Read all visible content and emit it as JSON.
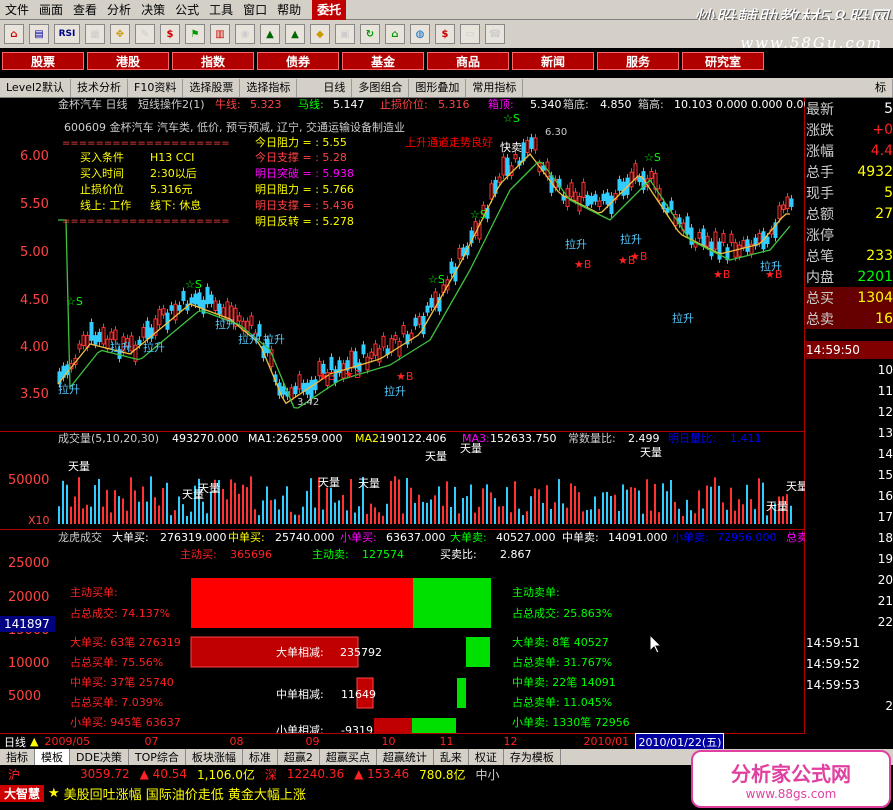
{
  "menu": [
    "文件",
    "画面",
    "查看",
    "分析",
    "决策",
    "公式",
    "工具",
    "窗口",
    "帮助",
    "委托"
  ],
  "brand": "炒股輔助教材58股网",
  "watermark": "www.58Gu.com",
  "toolbar": {
    "icons": [
      "home-icon",
      "chart-icon",
      "rsi-icon",
      "grid-icon",
      "cursor-icon",
      "pencil-icon",
      "dollar-icon",
      "flag-icon",
      "bars-icon",
      "binoculars-icon",
      "stack-icon",
      "stack2-icon",
      "diamond-icon",
      "note-icon",
      "rotate-icon",
      "home2-icon",
      "globe-icon",
      "dollar2-icon",
      "monitor-icon",
      "phone-icon"
    ],
    "rsi_label": "RSI",
    "dollar_label": "$"
  },
  "nav": [
    "股票",
    "港股",
    "指数",
    "债券",
    "基金",
    "商品",
    "新闻",
    "服务",
    "研究室"
  ],
  "subbar": [
    "Level2默认",
    "技术分析",
    "F10资料",
    "选择股票",
    "选择指标",
    "日线",
    "多图组合",
    "图形叠加",
    "常用指标",
    "标"
  ],
  "header": {
    "stock": "金杯汽车 日线",
    "indicator": "短线操作2(1)",
    "niuxian_label": "牛线:",
    "niuxian": "5.323",
    "maxian_label": "马线:",
    "maxian": "5.147",
    "stoploss_label": "止损价位:",
    "stoploss": "5.316",
    "box_top_label": "箱顶:",
    "box_top": "5.340",
    "box_bottom_label": "箱底:",
    "box_bottom": "4.850",
    "box_high_label": "箱高:",
    "box_high": "10.103",
    "v1": "0.000",
    "v2": "0.000",
    "v3": "0.000"
  },
  "info": {
    "code_line": "600609  金杯汽车  汽车类, 低价, 预亏预减, 辽宁, 交通运输设备制造业",
    "buy_cond_l": "买入条件",
    "buy_cond_v": "H13 CCI",
    "buy_time_l": "买入时间",
    "buy_time_v": "2:30以后",
    "stop_l": "止损价位",
    "stop_v": "5.316元",
    "online_l": "线上: 工作",
    "offline_l": "线下: 休息",
    "dashes": "====================",
    "today_res": "今日阻力 = : 5.55",
    "today_sup": "今日支撑 = : 5.28",
    "tomorrow_break": "明日突破 = : 5.938",
    "tomorrow_res": "明日阻力 = : 5.766",
    "tomorrow_sup": "明日支撑 = : 5.436",
    "tomorrow_rev": "明日反转 = : 5.278",
    "up_note": "上升通道走势良好"
  },
  "price_axis": [
    "6.00",
    "5.50",
    "5.00",
    "4.50",
    "4.00",
    "3.50"
  ],
  "markers": {
    "lasheng": "拉升",
    "kuaimai": "快卖",
    "star_s": "☆S",
    "star_b": "★B",
    "high": "6.30",
    "low": "3.42"
  },
  "volume": {
    "label": "成交量(5,10,20,30)",
    "value": "493270.000",
    "ma1_label": "MA1:",
    "ma1": "262559.000",
    "ma2_label": "MA2:",
    "ma2": "190122.406",
    "ma3_label": "MA3:",
    "ma3": "152633.750",
    "ratio_label": "常数量比:",
    "ratio": "2.499",
    "tianliang": "天量",
    "axis": [
      "50000",
      "X10"
    ],
    "extra_label": "明日量比:",
    "extra": "1.411"
  },
  "lhb": {
    "title": "龙虎成交",
    "big_buy_l": "大单买:",
    "big_buy": "276319.000",
    "mid_buy_l": "中单买:",
    "mid_buy": "25740.000",
    "small_buy_l": "小单买:",
    "small_buy": "63637.000",
    "big_sell_l": "大单卖:",
    "big_sell": "40527.000",
    "mid_sell_l": "中单卖:",
    "mid_sell": "14091.000",
    "small_sell_l": "小单卖:",
    "small_sell": "72956.000",
    "total_sell": "总卖",
    "active_buy_l": "主动买:",
    "active_buy": "365696",
    "active_sell_l": "主动卖:",
    "active_sell": "127574",
    "ratio_l": "买卖比:",
    "ratio": "2.867",
    "axis": [
      "25000",
      "20000",
      "15000",
      "10000",
      "5000"
    ],
    "highlight": "141897",
    "left": [
      "主动买单:",
      "占总成交: 74.137%",
      "大单买: 63笔 276319",
      "占总买单: 75.56%",
      "中单买: 37笔 25740",
      "占总买单: 7.039%",
      "小单买: 945笔 63637"
    ],
    "right": [
      "主动卖单:",
      "占总成交: 25.863%",
      "大单卖: 8笔 40527",
      "占总卖单: 31.767%",
      "中单卖: 22笔 14091",
      "占总卖单: 11.045%",
      "小单卖: 1330笔 72956"
    ],
    "big_diff_l": "大单相减:",
    "big_diff": "235792",
    "mid_diff_l": "中单相减:",
    "mid_diff": "11649",
    "small_diff_l": "小单相减:",
    "small_diff": "-9319"
  },
  "right_panel": {
    "labels": [
      "最新",
      "涨跌",
      "涨幅",
      "总手",
      "现手",
      "总额",
      "涨停",
      "总笔",
      "内盘",
      "总买",
      "总卖"
    ],
    "values": [
      "5",
      "+0",
      "4.4",
      "4932",
      "5",
      "27",
      "",
      "233",
      "2201",
      "1304",
      "16"
    ],
    "times": [
      "14:59:50",
      "10",
      "11",
      "12",
      "13",
      "14",
      "15",
      "16",
      "17",
      "18",
      "19",
      "20",
      "21",
      "22",
      "14:59:51",
      "14:59:52",
      "14:59:53",
      "2"
    ]
  },
  "timeline": {
    "label": "日线",
    "dates": [
      "2009/05",
      "07",
      "08",
      "09",
      "10",
      "11",
      "12",
      "2010/01",
      "2010/01/22(五)"
    ]
  },
  "bottom_tabs": [
    "指标",
    "模板",
    "DDE决策",
    "TOP综合",
    "板块涨幅",
    "标准",
    "超赢2",
    "超赢买点",
    "超赢统计",
    "乱来",
    "权证",
    "存为模板"
  ],
  "index": {
    "sh": "沪",
    "sh_val": "3059.72",
    "sh_chg": "▲ 40.54",
    "sh_amt": "1,106.0亿",
    "sz": "深",
    "sz_val": "12240.36",
    "sz_chg": "▲ 153.46",
    "sz_amt": "780.8亿",
    "zx": "中小"
  },
  "news": {
    "tag": "大智慧",
    "text": "美股回吐涨幅 国际油价走低 黄金大幅上涨"
  },
  "site": {
    "title": "分析家公式网",
    "url": "www.88gs.com"
  }
}
